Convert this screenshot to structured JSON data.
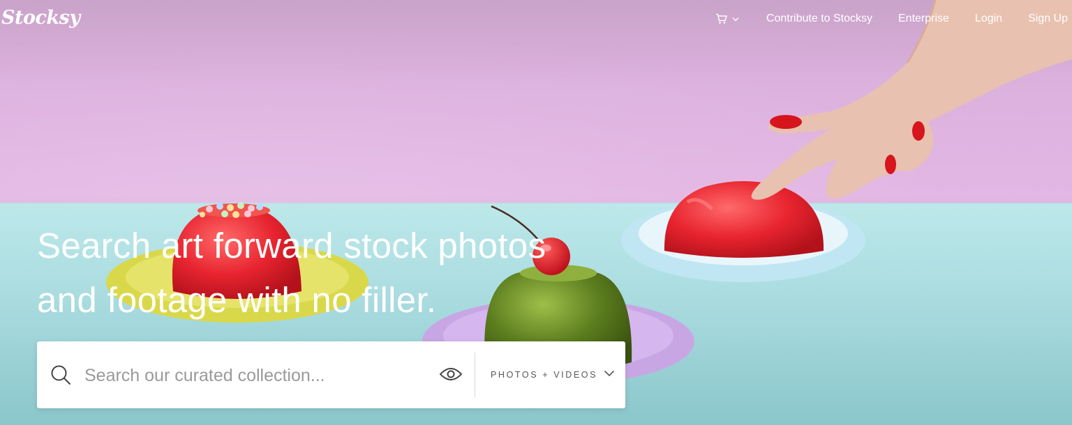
{
  "header": {
    "logo": "Stocksy",
    "cart_icon": "cart-icon",
    "nav": [
      {
        "label": "Contribute to Stocksy"
      },
      {
        "label": "Enterprise"
      },
      {
        "label": "Login"
      },
      {
        "label": "Sign Up"
      }
    ]
  },
  "hero": {
    "headline_line1": "Search art forward stock photos",
    "headline_line2": "and footage with no filler.",
    "colors": {
      "wall": "#e3b7e4",
      "table": "#a6e0e4",
      "jelly_red": "#e8242f",
      "jelly_green": "#5c7d1e"
    }
  },
  "search": {
    "placeholder": "Search our curated collection...",
    "value": "",
    "search_icon": "search-icon",
    "preview_icon": "eye-icon",
    "type_selected": "PHOTOS + VIDEOS",
    "type_icon": "chevron-down-icon"
  }
}
